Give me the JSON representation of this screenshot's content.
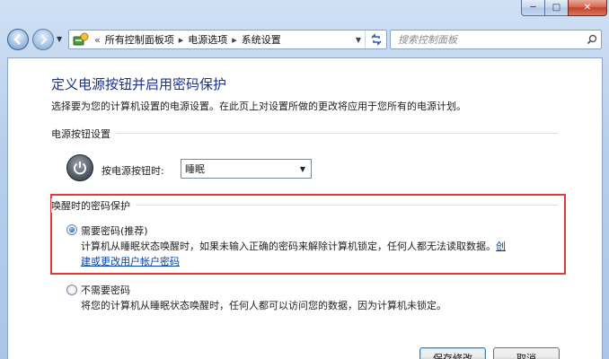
{
  "window": {
    "minimize_glyph": "─",
    "maximize_glyph": "□",
    "close_glyph": "✕"
  },
  "nav": {
    "breadcrumb_prefix": "«",
    "breadcrumbs": [
      "所有控制面板项",
      "电源选项",
      "系统设置"
    ],
    "separator": "▸",
    "search_placeholder": "搜索控制面板"
  },
  "page": {
    "title": "定义电源按钮并启用密码保护",
    "description": "选择要为您的计算机设置的电源设置。在此页上对设置所做的更改将应用于您所有的电源计划。"
  },
  "power_section": {
    "label": "电源按钮设置",
    "power_button_label": "按电源按钮时:",
    "power_button_value": "睡眠"
  },
  "wake_section": {
    "label": "唤醒时的密码保护",
    "options": [
      {
        "label": "需要密码(推荐)",
        "selected": true,
        "text_line1": "计算机从睡眠状态唤醒时，如果未输入正确的密码来解除计算机锁定，任何人都无法读取数据。",
        "link_part1": "创",
        "link_part2": "建或更改用户帐户密码"
      },
      {
        "label": "不需要密码",
        "selected": false,
        "text_line1": "将您的计算机从睡眠状态唤醒时，任何人都可以访问您的数据，因为计算机未锁定。"
      }
    ]
  },
  "buttons": {
    "save": "保存修改",
    "cancel": "取消"
  },
  "colors": {
    "highlight_border": "#e03a3a",
    "title": "#1e3287",
    "link": "#0645ad"
  }
}
